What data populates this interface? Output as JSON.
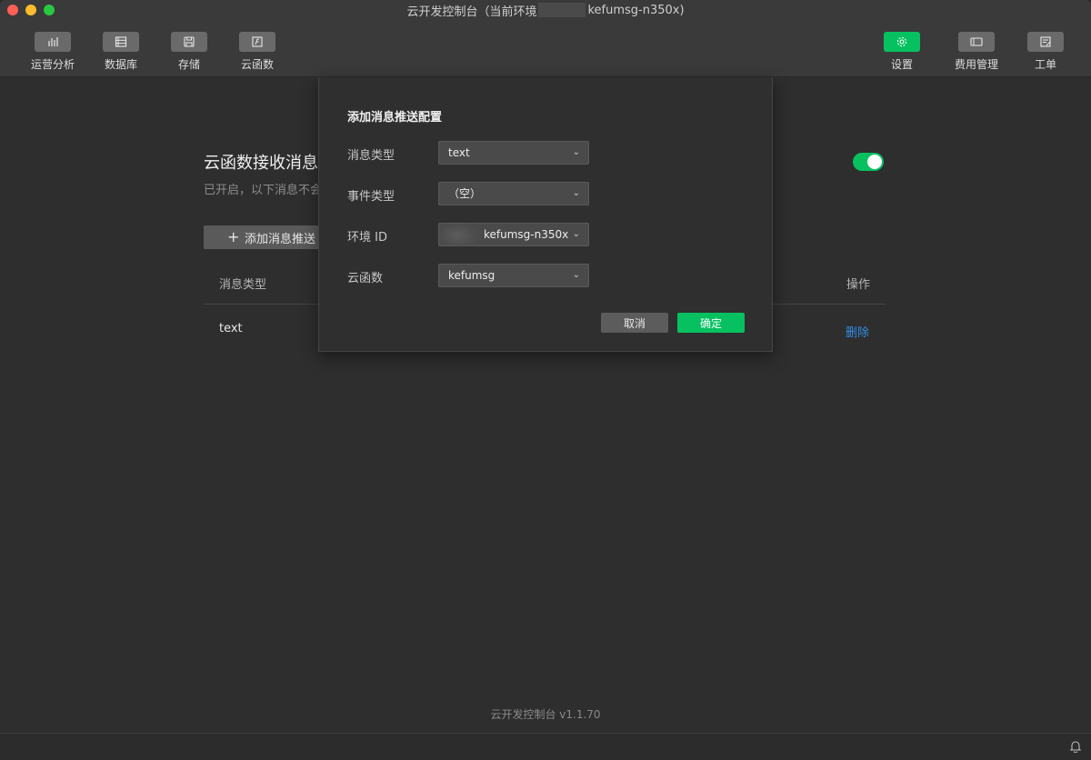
{
  "window": {
    "title_prefix": "云开发控制台（当前环境",
    "title_suffix": "kefumsg-n350x)"
  },
  "toolbar": {
    "left": [
      {
        "label": "运营分析",
        "icon": "bar-chart-icon"
      },
      {
        "label": "数据库",
        "icon": "database-icon"
      },
      {
        "label": "存储",
        "icon": "storage-icon"
      },
      {
        "label": "云函数",
        "icon": "cloud-function-icon"
      }
    ],
    "right": [
      {
        "label": "设置",
        "icon": "gear-icon",
        "active": true
      },
      {
        "label": "费用管理",
        "icon": "billing-icon"
      },
      {
        "label": "工单",
        "icon": "ticket-icon"
      }
    ]
  },
  "page": {
    "section_title": "云函数接收消息推",
    "section_desc": "已开启，以下消息不会",
    "toggle_on": true,
    "add_button": "添加消息推送",
    "table": {
      "headers": [
        "消息类型",
        "操作"
      ],
      "rows": [
        {
          "type": "text",
          "action": "删除"
        }
      ]
    },
    "version": "云开发控制台 v1.1.70"
  },
  "dialog": {
    "title": "添加消息推送配置",
    "fields": [
      {
        "label": "消息类型",
        "value": "text"
      },
      {
        "label": "事件类型",
        "value": "（空）"
      },
      {
        "label": "环境 ID",
        "value": "kefumsg-n350x"
      },
      {
        "label": "云函数",
        "value": "kefumsg"
      }
    ],
    "cancel": "取消",
    "confirm": "确定"
  },
  "colors": {
    "accent": "#07c160",
    "link": "#2f8fe8",
    "background": "#2e2e2e"
  }
}
